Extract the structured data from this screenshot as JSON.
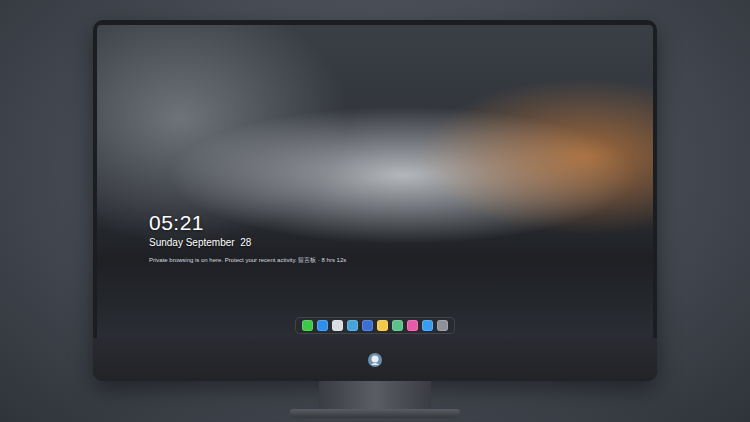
{
  "lock_screen": {
    "time": "05:21",
    "date": "Sunday September  28",
    "notice": "Private browsing is on here. Protect your recent activity. 留言板 · 8 hrs 12s"
  },
  "dock": {
    "apps": [
      {
        "color": "#3ec74a"
      },
      {
        "color": "#2f8fe8"
      },
      {
        "color": "#d9dde2"
      },
      {
        "color": "#4aa3d8"
      },
      {
        "color": "#3b6fd1"
      },
      {
        "color": "#f2c94c"
      },
      {
        "color": "#5cc08a"
      },
      {
        "color": "#e85aa8"
      },
      {
        "color": "#3a9bf0"
      },
      {
        "color": "#8d9299"
      }
    ]
  }
}
